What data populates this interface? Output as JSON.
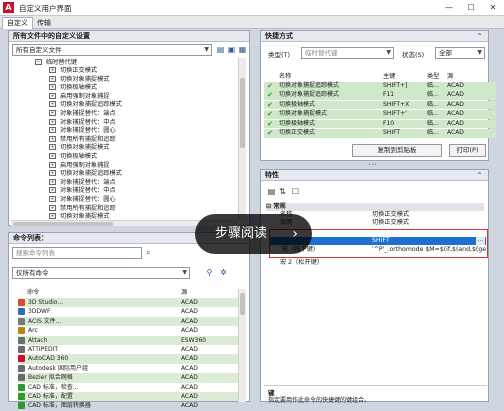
{
  "window": {
    "title": "自定义用户界面",
    "logo": "A"
  },
  "tabs": [
    "自定义",
    "传输"
  ],
  "left_top": {
    "header": "所有文件中的自定义设置",
    "combo_value": "所有自定义文件",
    "tree_parent": "临时替代键",
    "tree_items": [
      "切换正交模式",
      "切换对象捕捉模式",
      "切换极轴模式",
      "启用强制对象捕捉",
      "切换对象捕捉追踪模式",
      "对象捕捉替代：端点",
      "对象捕捉替代：中点",
      "对象捕捉替代：圆心",
      "禁用所有捕捉和追踪",
      "切换对象捕捉模式",
      "切换极轴模式",
      "启用强制对象捕捉",
      "切换对象捕捉追踪模式",
      "对象捕捉替代：端点",
      "对象捕捉替代：中点",
      "对象捕捉替代：圆心",
      "禁用所有捕捉和追踪",
      "切换对象捕捉模式"
    ]
  },
  "commands": {
    "header": "命令列表：",
    "search_placeholder": "搜索命令列表",
    "filter_value": "仅所有命令",
    "col_command": "命令",
    "col_source": "源",
    "rows": [
      {
        "name": "3D Studio...",
        "source": "ACAD",
        "color": "#d94a3a"
      },
      {
        "name": "3DDWF",
        "source": "ACAD",
        "color": "#2f6fb6"
      },
      {
        "name": "ACIS 文件...",
        "source": "ACAD",
        "color": "#7a7a7a"
      },
      {
        "name": "Arc",
        "source": "ACAD",
        "color": "#b8860b"
      },
      {
        "name": "Attach",
        "source": "ESW360",
        "color": "#6c6c6c"
      },
      {
        "name": "ATTIPEDIT",
        "source": "ACAD",
        "color": "#6c6c6c"
      },
      {
        "name": "AutoCAD 360",
        "source": "ACAD",
        "color": "#c8102e"
      },
      {
        "name": "Autodesk 国际用户组",
        "source": "ACAD",
        "color": "#6c6c6c"
      },
      {
        "name": "Bezier 拟合网格",
        "source": "ACAD",
        "color": "#6c6c6c"
      },
      {
        "name": "CAD 标准，检查...",
        "source": "ACAD",
        "color": "#2e9a2e"
      },
      {
        "name": "CAD 标准，配置",
        "source": "ACAD",
        "color": "#2e9a2e"
      },
      {
        "name": "CAD 标准，图层转换器",
        "source": "ACAD",
        "color": "#2e9a2e"
      }
    ]
  },
  "shortcuts": {
    "header": "快捷方式",
    "type_label": "类型(T)",
    "type_value": "临时替代键",
    "status_label": "状态(S)",
    "status_value": "全部",
    "col_name": "名称",
    "col_key": "主键",
    "col_type": "类型",
    "col_source": "源",
    "rows": [
      {
        "name": "切换对象捕捉追踪模式",
        "key": "SHIFT+]",
        "type": "临...",
        "source": "ACAD"
      },
      {
        "name": "切换对象捕捉追踪模式",
        "key": "F11",
        "type": "临...",
        "source": "ACAD"
      },
      {
        "name": "切换极轴模式",
        "key": "SHIFT+X",
        "type": "临...",
        "source": "ACAD"
      },
      {
        "name": "切换对象捕捉模式",
        "key": "SHIFT+'",
        "type": "临...",
        "source": "ACAD"
      },
      {
        "name": "切换极轴模式",
        "key": "F10",
        "type": "临...",
        "source": "ACAD"
      },
      {
        "name": "切换正交模式",
        "key": "SHIFT",
        "type": "临...",
        "source": "ACAD"
      }
    ],
    "copy_button": "复制到剪贴板",
    "print_button": "打印(P)"
  },
  "properties": {
    "header": "特性",
    "section": "常规",
    "rows": [
      {
        "label": "名称",
        "value": "切换正交模式"
      },
      {
        "label": "说明",
        "value": "切换正交模式"
      }
    ],
    "key_value": "SHIFT",
    "macro_label": "宏（按下键）",
    "macro_value": "'^P'_.orthomode $M=$(if,$(and,$(getv",
    "key2_label": "宏 2（松开键）",
    "footer_title": "键",
    "footer_text": "指定要用作此命令的快捷键的键组合。"
  },
  "overlay": {
    "text": "步骤阅读",
    "chevron": "›"
  }
}
